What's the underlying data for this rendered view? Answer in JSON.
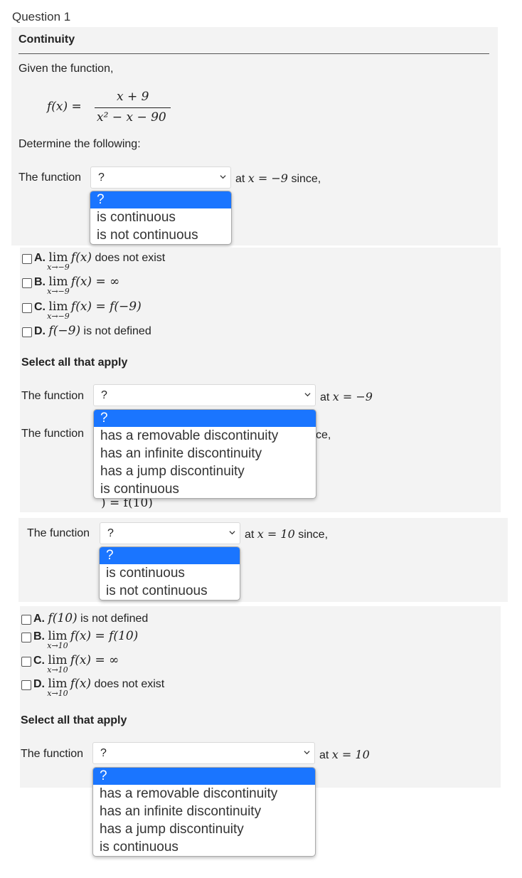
{
  "question_label": "Question 1",
  "section_title": "Continuity",
  "intro": "Given the function,",
  "function": {
    "lhs": "f(x) =",
    "numerator": "x + 9",
    "denominator": "x² − x − 90"
  },
  "determine": "Determine the following:",
  "part1": {
    "prefix": "The function",
    "selected": "?",
    "suffix_at": "at",
    "suffix_eq": "x = −9",
    "suffix_since": "since,",
    "options": [
      "?",
      "is continuous",
      "is not continuous"
    ],
    "choices": [
      {
        "letter": "A.",
        "lim": "lim",
        "sub": "x→−9",
        "expr": "f(x)",
        "tail": "does not exist"
      },
      {
        "letter": "B.",
        "lim": "lim",
        "sub": "x→−9",
        "expr": "f(x) = ∞",
        "tail": ""
      },
      {
        "letter": "C.",
        "lim": "lim",
        "sub": "x→−9",
        "expr": "f(x) = f(−9)",
        "tail": ""
      },
      {
        "letter": "D.",
        "lim": "",
        "sub": "",
        "expr": "f(−9)",
        "tail": "is not defined"
      }
    ],
    "select_all": "Select all that apply"
  },
  "part2": {
    "prefix": "The function",
    "selected": "?",
    "suffix_at": "at",
    "suffix_eq": "x = −9",
    "second_prefix": "The function",
    "partial_tail": "ce,",
    "partial_math": ") = f(10)",
    "options": [
      "?",
      "has a removable discontinuity",
      "has an infinite discontinuity",
      "has a jump discontinuity",
      "is continuous"
    ]
  },
  "part3": {
    "prefix": "The function",
    "selected": "?",
    "suffix_at": "at",
    "suffix_eq": "x = 10",
    "suffix_since": "since,",
    "options": [
      "?",
      "is continuous",
      "is not continuous"
    ],
    "choices": [
      {
        "letter": "A.",
        "lim": "",
        "sub": "",
        "expr": "f(10)",
        "tail": "is not defined"
      },
      {
        "letter": "B.",
        "lim": "lim",
        "sub": "x→10",
        "expr": "f(x) = f(10)",
        "tail": ""
      },
      {
        "letter": "C.",
        "lim": "lim",
        "sub": "x→10",
        "expr": "f(x) = ∞",
        "tail": ""
      },
      {
        "letter": "D.",
        "lim": "lim",
        "sub": "x→10",
        "expr": "f(x)",
        "tail": "does not exist"
      }
    ],
    "select_all": "Select all that apply"
  },
  "part4": {
    "prefix": "The function",
    "selected": "?",
    "suffix_at": "at",
    "suffix_eq": "x = 10",
    "options": [
      "?",
      "has a removable discontinuity",
      "has an infinite discontinuity",
      "has a jump discontinuity",
      "is continuous"
    ]
  },
  "colors": {
    "highlight": "#1a75ff",
    "panel": "#f3f3f3"
  }
}
